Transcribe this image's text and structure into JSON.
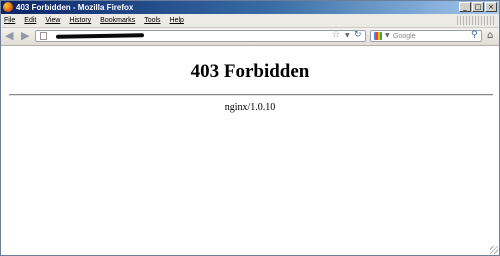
{
  "window": {
    "title": "403 Forbidden - Mozilla Firefox",
    "controls": {
      "minimize": "_",
      "maximize": "□",
      "close": "×"
    }
  },
  "menu": {
    "items": [
      "File",
      "Edit",
      "View",
      "History",
      "Bookmarks",
      "Tools",
      "Help"
    ]
  },
  "navbar": {
    "back_icon": "back-arrow-icon",
    "forward_icon": "forward-arrow-icon",
    "url_value": "",
    "search_placeholder": "Google",
    "icons": [
      "bookmark-star-icon",
      "reload-icon",
      "google-icon",
      "search-icon",
      "home-icon"
    ]
  },
  "page": {
    "heading": "403 Forbidden",
    "server": "nginx/1.0.10"
  }
}
